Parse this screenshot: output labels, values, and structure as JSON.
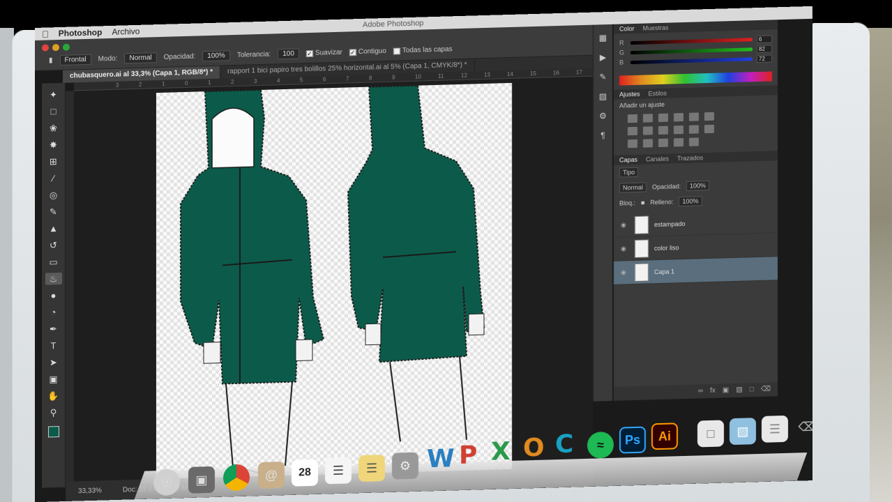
{
  "menubar": {
    "app": "Photoshop",
    "menu2": "Archivo",
    "window_title": "Adobe Photoshop"
  },
  "options": {
    "tool_preset": "Frontal",
    "mode_label": "Modo:",
    "mode_value": "Normal",
    "opacity_label": "Opacidad:",
    "opacity_value": "100%",
    "tolerance_label": "Tolerancia:",
    "tolerance_value": "100",
    "suavizar": "Suavizar",
    "contiguo": "Contiguo",
    "todas_capas": "Todas las capas"
  },
  "tabs": [
    {
      "label": "chubasquero.ai al 33,3% (Capa 1, RGB/8*) *"
    },
    {
      "label": "rapport 1 bici papiro tres bolillos 25% horizontal.ai al 5% (Capa 1, CMYK/8*) *"
    }
  ],
  "ruler": [
    "3",
    "2",
    "1",
    "0",
    "1",
    "2",
    "3",
    "4",
    "5",
    "6",
    "7",
    "8",
    "9",
    "10",
    "11",
    "12",
    "13",
    "14",
    "15",
    "16",
    "17"
  ],
  "status": {
    "zoom": "33,33%",
    "doc": "Doc: 11,2 MB/18,3 MB"
  },
  "colors": {
    "fill": "#0c5b4a",
    "outline": "#1a1a1a"
  },
  "panels": {
    "color_tabs": [
      "Color",
      "Muestras"
    ],
    "color_rows": [
      {
        "label": "R",
        "value": "6"
      },
      {
        "label": "G",
        "value": "82"
      },
      {
        "label": "B",
        "value": "72"
      }
    ],
    "adjust_tabs": [
      "Ajustes",
      "Estilos"
    ],
    "adjust_title": "Añadir un ajuste",
    "layers_tabs": [
      "Capas",
      "Canales",
      "Trazados"
    ],
    "kind_label": "Tipo",
    "blend_mode": "Normal",
    "opacity_label": "Opacidad:",
    "opacity_value": "100%",
    "lock_label": "Bloq.:",
    "fill_label": "Relleno:",
    "fill_value": "100%",
    "layers": [
      {
        "name": "estampado",
        "selected": false
      },
      {
        "name": "color liso",
        "selected": false
      },
      {
        "name": "Capa 1",
        "selected": true
      }
    ]
  },
  "dock": {
    "calendar_day": "28",
    "letters": [
      {
        "char": "W",
        "color": "#2a7fc0"
      },
      {
        "char": "P",
        "color": "#d04030"
      },
      {
        "char": "X",
        "color": "#2a9a4a"
      },
      {
        "char": "O",
        "color": "#e08a20"
      },
      {
        "char": "C",
        "color": "#1aa0c0"
      }
    ],
    "ps_label": "Ps",
    "ai_label": "Ai"
  }
}
